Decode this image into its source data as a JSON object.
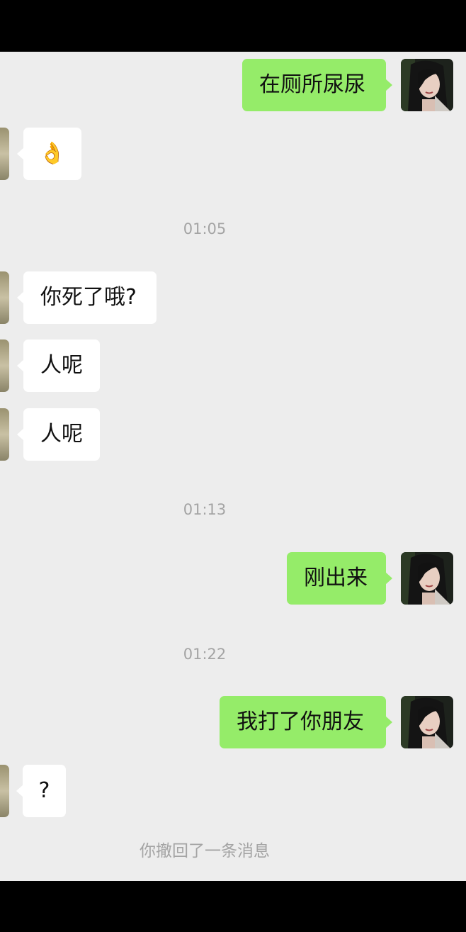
{
  "chat": {
    "messages": [
      {
        "side": "out",
        "text": "在厕所尿尿"
      },
      {
        "side": "in",
        "text": "👌"
      },
      {
        "type": "time",
        "text": "01:05"
      },
      {
        "side": "in",
        "text": "你死了哦?"
      },
      {
        "side": "in",
        "text": "人呢"
      },
      {
        "side": "in",
        "text": "人呢"
      },
      {
        "type": "time",
        "text": "01:13"
      },
      {
        "side": "out",
        "text": "刚出来"
      },
      {
        "type": "time",
        "text": "01:22"
      },
      {
        "side": "out",
        "text": "我打了你朋友"
      },
      {
        "side": "in",
        "text": "?"
      },
      {
        "type": "system",
        "text": "你撤回了一条消息"
      }
    ]
  },
  "colors": {
    "chat_background": "#ededed",
    "outgoing_bubble": "#95ec69",
    "incoming_bubble": "#ffffff",
    "meta_text": "#a4a4a4",
    "frame": "#000000"
  },
  "icons": {
    "self_avatar": "user-avatar-photo",
    "contact_avatar": "contact-avatar-photo"
  }
}
